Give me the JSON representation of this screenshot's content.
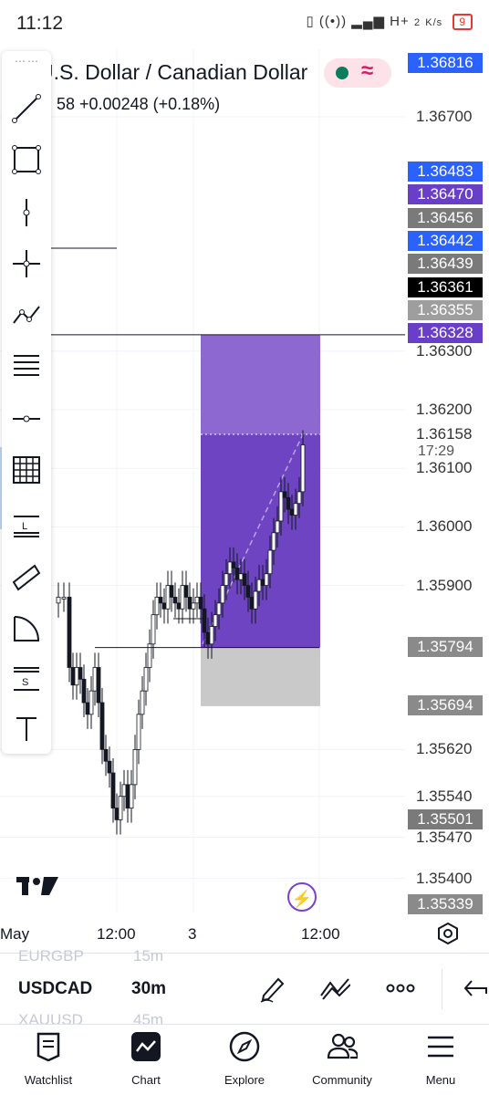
{
  "status_bar": {
    "time": "11:12",
    "network": "H+",
    "speed_value": "2",
    "speed_unit": "K/s",
    "battery": "9"
  },
  "header": {
    "symbol_title": "U.S. Dollar / Canadian Dollar",
    "change_text": "58   +0.00248 (+0.18%)"
  },
  "price_axis": {
    "labels": [
      {
        "text": "1.36700"
      },
      {
        "text": "1.36300"
      },
      {
        "text": "1.36200"
      },
      {
        "text": "1.36100"
      },
      {
        "text": "1.36000"
      },
      {
        "text": "1.35900"
      },
      {
        "text": "1.35620"
      },
      {
        "text": "1.35540"
      },
      {
        "text": "1.35470"
      },
      {
        "text": "1.35400"
      }
    ],
    "tags": [
      {
        "text": "1.36816",
        "color": "#2962ff"
      },
      {
        "text": "1.36483",
        "color": "#2962ff"
      },
      {
        "text": "1.36470",
        "color": "#6a3fc8"
      },
      {
        "text": "1.36456",
        "color": "#7a7a7a"
      },
      {
        "text": "1.36442",
        "color": "#2962ff"
      },
      {
        "text": "1.36439",
        "color": "#7a7a7a"
      },
      {
        "text": "1.36361",
        "color": "#000000"
      },
      {
        "text": "1.36355",
        "color": "#9e9e9e"
      },
      {
        "text": "1.36328",
        "color": "#6a3fc8"
      },
      {
        "text": "1.35794",
        "color": "#8a8a8a"
      },
      {
        "text": "1.35694",
        "color": "#8a8a8a"
      },
      {
        "text": "1.35501",
        "color": "#7a7a7a"
      },
      {
        "text": "1.35339",
        "color": "#8a8a8a"
      }
    ],
    "last_price": "1.36158",
    "countdown": "17:29"
  },
  "position_tool": {
    "profit_color": "#6e44c2",
    "profit_light_color": "#8c68d0",
    "loss_color": "#c9c9c9"
  },
  "time_axis": {
    "labels": [
      "May",
      "12:00",
      "3",
      "12:00"
    ]
  },
  "toolbar": {
    "tools": [
      "trend-line-icon",
      "rectangle-icon",
      "vertical-line-icon",
      "cross-line-icon",
      "path-icon",
      "fib-retracement-icon",
      "horizontal-ray-icon",
      "grid-icon",
      "long-position-icon",
      "parallel-channel-icon",
      "arc-icon",
      "short-position-icon",
      "text-icon"
    ]
  },
  "bottom_bar": {
    "prev_symbol": "EURGBP",
    "prev_interval": "15m",
    "symbol": "USDCAD",
    "interval": "30m",
    "next_symbol": "XAUUSD",
    "next_interval": "45m"
  },
  "nav": [
    {
      "label": "Watchlist",
      "icon": "watchlist-icon"
    },
    {
      "label": "Chart",
      "icon": "chart-icon"
    },
    {
      "label": "Explore",
      "icon": "compass-icon"
    },
    {
      "label": "Community",
      "icon": "community-icon"
    },
    {
      "label": "Menu",
      "icon": "menu-icon"
    }
  ]
}
